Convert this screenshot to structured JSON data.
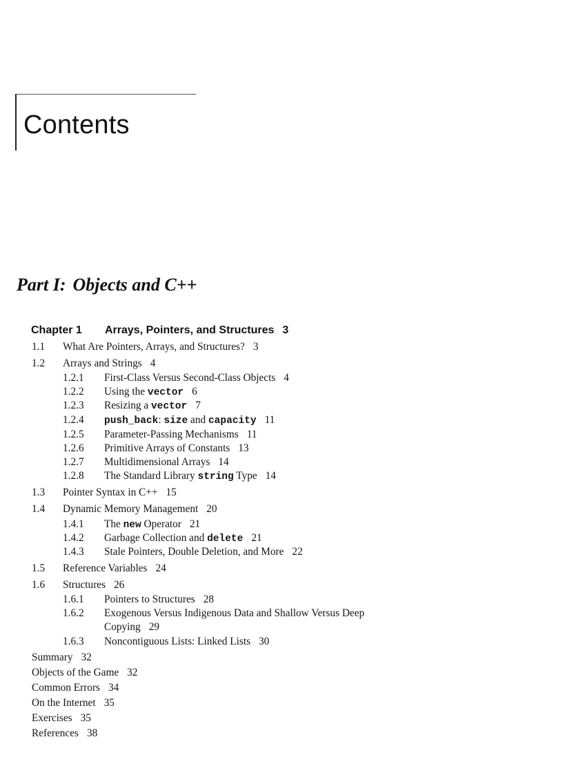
{
  "header": {
    "title": "Contents"
  },
  "part": {
    "label": "Part I:",
    "title": "Objects and C++"
  },
  "chapter": {
    "label": "Chapter 1",
    "title": "Arrays, Pointers, and Structures",
    "page": "3"
  },
  "entries": [
    {
      "num": "1.1",
      "title": "What Are Pointers, Arrays, and Structures?",
      "page": "3"
    },
    {
      "num": "1.2",
      "title": "Arrays and Strings",
      "page": "4"
    },
    {
      "num": "1.2.1",
      "title": "First-Class Versus Second-Class Objects",
      "page": "4"
    },
    {
      "num": "1.2.2",
      "pre": "Using the ",
      "code": "vector",
      "post": "",
      "page": "6"
    },
    {
      "num": "1.2.3",
      "pre": "Resizing a ",
      "code": "vector",
      "post": "",
      "page": "7"
    },
    {
      "num": "1.2.4",
      "code1": "push_back",
      "mid1": ": ",
      "code2": "size",
      "mid2": " and ",
      "code3": "capacity",
      "page": "11"
    },
    {
      "num": "1.2.5",
      "title": "Parameter-Passing Mechanisms",
      "page": "11"
    },
    {
      "num": "1.2.6",
      "title": "Primitive Arrays of Constants",
      "page": "13"
    },
    {
      "num": "1.2.7",
      "title": "Multidimensional Arrays",
      "page": "14"
    },
    {
      "num": "1.2.8",
      "pre": "The Standard Library ",
      "code": "string",
      "post": " Type",
      "page": "14"
    },
    {
      "num": "1.3",
      "title": "Pointer Syntax in C++",
      "page": "15"
    },
    {
      "num": "1.4",
      "title": "Dynamic Memory Management",
      "page": "20"
    },
    {
      "num": "1.4.1",
      "pre": "The ",
      "code": "new",
      "post": " Operator",
      "page": "21"
    },
    {
      "num": "1.4.2",
      "pre": "Garbage Collection and ",
      "code": "delete",
      "post": "",
      "page": "21"
    },
    {
      "num": "1.4.3",
      "title": "Stale Pointers, Double Deletion, and More",
      "page": "22"
    },
    {
      "num": "1.5",
      "title": "Reference Variables",
      "page": "24"
    },
    {
      "num": "1.6",
      "title": "Structures",
      "page": "26"
    },
    {
      "num": "1.6.1",
      "title": "Pointers to Structures",
      "page": "28"
    },
    {
      "num": "1.6.2",
      "title": "Exogenous Versus Indigenous Data and Shallow Versus Deep",
      "title_cont": "Copying",
      "page": "29"
    },
    {
      "num": "1.6.3",
      "title": "Noncontiguous Lists: Linked Lists",
      "page": "30"
    }
  ],
  "end_sections": [
    {
      "title": "Summary",
      "page": "32"
    },
    {
      "title": "Objects of the Game",
      "page": "32"
    },
    {
      "title": "Common Errors",
      "page": "34"
    },
    {
      "title": "On the Internet",
      "page": "35"
    },
    {
      "title": "Exercises",
      "page": "35"
    },
    {
      "title": "References",
      "page": "38"
    }
  ]
}
